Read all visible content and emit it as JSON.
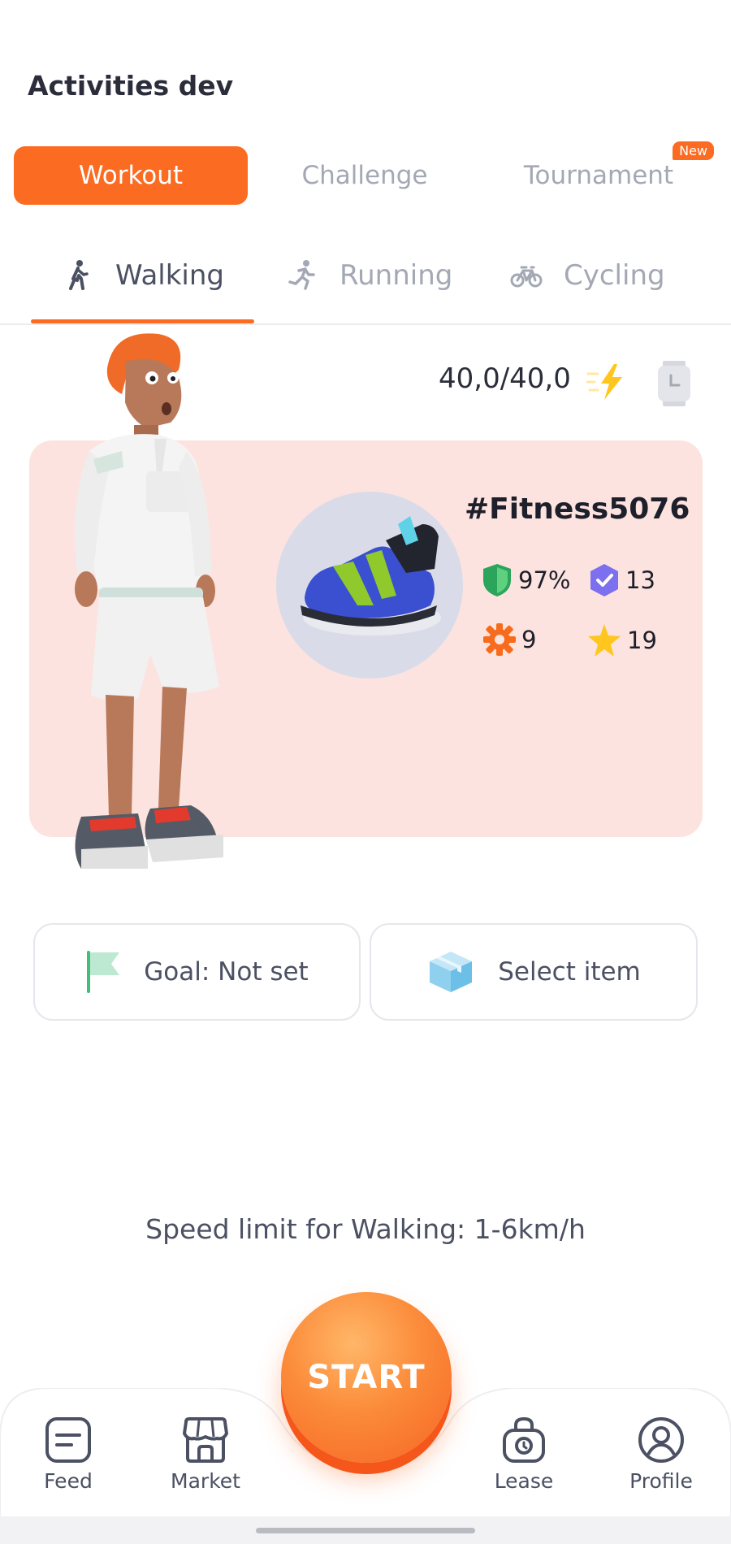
{
  "header": {
    "title": "Activities dev"
  },
  "mode_tabs": [
    {
      "label": "Workout",
      "active": true
    },
    {
      "label": "Challenge",
      "active": false
    },
    {
      "label": "Tournament",
      "active": false,
      "badge": "New"
    }
  ],
  "activity_tabs": [
    {
      "label": "Walking",
      "icon": "walking-icon",
      "active": true
    },
    {
      "label": "Running",
      "icon": "running-icon",
      "active": false
    },
    {
      "label": "Cycling",
      "icon": "bicycle-icon",
      "active": false
    }
  ],
  "energy": {
    "value": "40,0/40,0",
    "icon": "lightning-icon"
  },
  "item_card": {
    "name": "#Fitness5076",
    "stats": {
      "durability": "97%",
      "level": "13",
      "efficiency": "9",
      "luck": "19"
    }
  },
  "actions": {
    "goal_label": "Goal: Not set",
    "select_item_label": "Select item"
  },
  "speed_limit": "Speed limit for Walking: 1-6km/h",
  "start_label": "START",
  "bottom_nav": [
    {
      "label": "Feed",
      "icon": "feed-icon"
    },
    {
      "label": "Market",
      "icon": "market-icon"
    },
    {
      "label": "Lease",
      "icon": "lease-icon"
    },
    {
      "label": "Profile",
      "icon": "profile-icon"
    }
  ],
  "colors": {
    "accent": "#fb6b22",
    "card_bg": "#fde3df",
    "text_muted": "#a3a8b4",
    "text_dark": "#2b2e3a"
  }
}
